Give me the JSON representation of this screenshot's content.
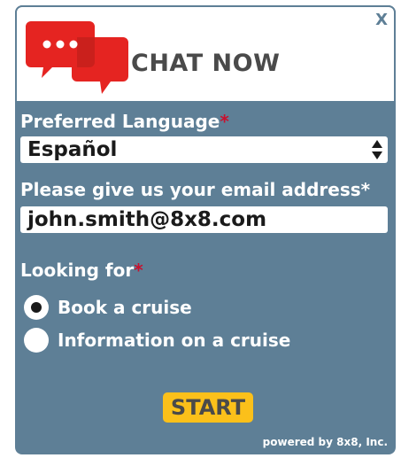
{
  "header": {
    "title": "CHAT NOW",
    "close_label": "X",
    "logo_icon": "chat-bubbles-icon",
    "logo_color": "#e52421",
    "logo_shadow_color": "#b51d1a"
  },
  "form": {
    "language": {
      "label": "Preferred Language",
      "required_mark": "*",
      "value": "Español"
    },
    "email": {
      "label": "Please give us your email address*",
      "value": "john.smith@8x8.com"
    },
    "looking_for": {
      "label": "Looking for",
      "required_mark": "*",
      "options": [
        {
          "label": "Book a cruise",
          "selected": true
        },
        {
          "label": "Information on a cruise",
          "selected": false
        }
      ]
    },
    "submit_label": "START"
  },
  "footer": {
    "powered_by": "powered by 8x8, Inc."
  },
  "colors": {
    "panel": "#5e7f96",
    "required": "#c8102e",
    "start_button": "#fbc01a",
    "title_text": "#4a4a4a"
  }
}
